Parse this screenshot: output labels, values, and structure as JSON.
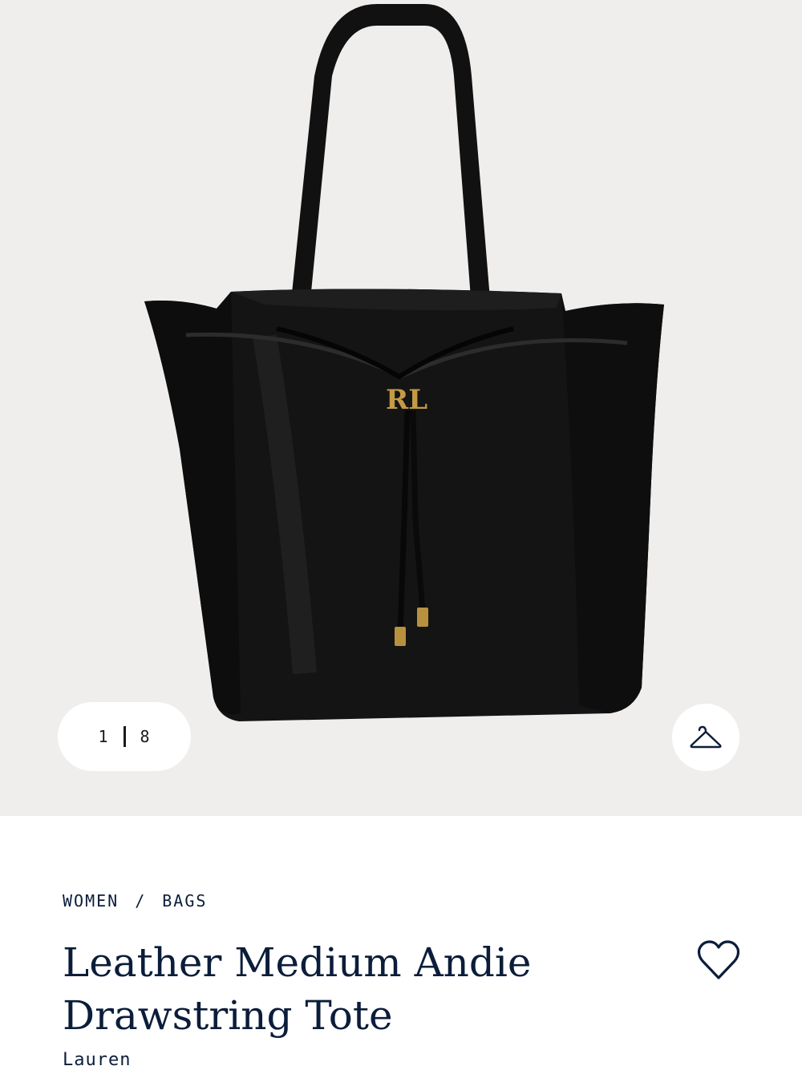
{
  "gallery": {
    "current_index": "1",
    "total_count": "8",
    "image_alt": "Black leather drawstring tote bag with gold RL logo"
  },
  "product": {
    "breadcrumb": [
      "WOMEN",
      "BAGS"
    ],
    "title": "Leather Medium Andie Drawstring Tote",
    "brand": "Lauren",
    "logo_text": "RL"
  },
  "icons": {
    "try_on": "hanger-icon",
    "wishlist": "heart-icon"
  },
  "colors": {
    "gallery_bg": "#efeeec",
    "text": "#0b1d3a",
    "bag": "#141414",
    "gold": "#b8913f"
  }
}
